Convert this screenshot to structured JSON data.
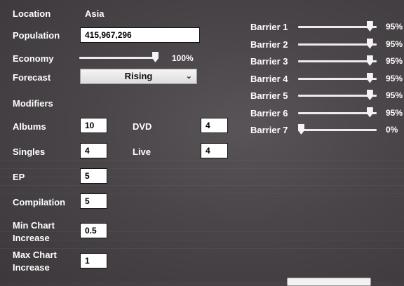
{
  "location": {
    "label": "Location",
    "value": "Asia"
  },
  "population": {
    "label": "Population",
    "value": "415,967,296"
  },
  "economy": {
    "label": "Economy",
    "value": 1.0,
    "value_text": "100%"
  },
  "forecast": {
    "label": "Forecast",
    "selected": "Rising"
  },
  "modifiers": {
    "heading": "Modifiers",
    "albums": {
      "label": "Albums",
      "value": "10"
    },
    "singles": {
      "label": "Singles",
      "value": "4"
    },
    "ep": {
      "label": "EP",
      "value": "5"
    },
    "compilation": {
      "label": "Compilation",
      "value": "5"
    },
    "dvd": {
      "label": "DVD",
      "value": "4"
    },
    "live": {
      "label": "Live",
      "value": "4"
    },
    "min_chart": {
      "label_line1": "Min Chart",
      "label_line2": "Increase",
      "value": "0.5"
    },
    "max_chart": {
      "label_line1": "Max Chart",
      "label_line2": "Increase",
      "value": "1"
    }
  },
  "barriers": [
    {
      "label": "Barrier 1",
      "value": 0.95,
      "value_text": "95%"
    },
    {
      "label": "Barrier 2",
      "value": 0.95,
      "value_text": "95%"
    },
    {
      "label": "Barrier 3",
      "value": 0.95,
      "value_text": "95%"
    },
    {
      "label": "Barrier 4",
      "value": 0.95,
      "value_text": "95%"
    },
    {
      "label": "Barrier 5",
      "value": 0.95,
      "value_text": "95%"
    },
    {
      "label": "Barrier 6",
      "value": 0.95,
      "value_text": "95%"
    },
    {
      "label": "Barrier 7",
      "value": 0.0,
      "value_text": "0%"
    }
  ],
  "icons": {
    "forecast_dropdown": "chevron-down-icon"
  }
}
